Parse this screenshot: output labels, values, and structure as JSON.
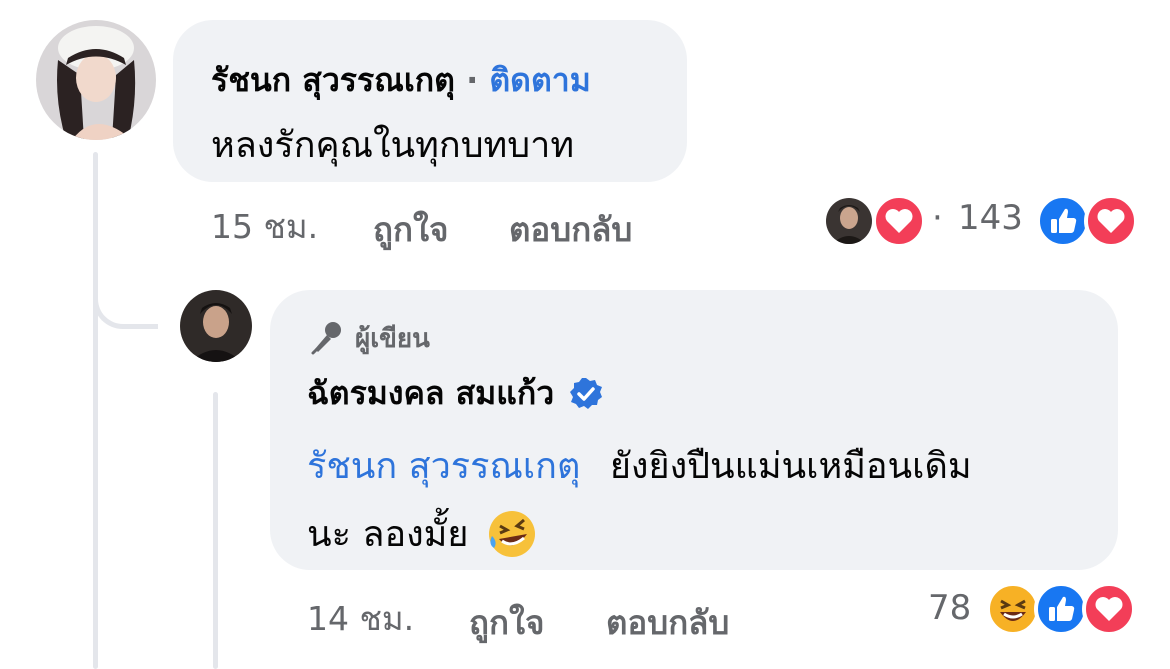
{
  "comment": {
    "author": "รัชนก สุวรรณเกตุ",
    "separator": "·",
    "follow_label": "ติดตาม",
    "text": "หลงรักคุณในทุกบทบาท",
    "time": "15 ชม.",
    "like_label": "ถูกใจ",
    "reply_label": "ตอบกลับ",
    "reaction_dot": "·",
    "reaction_count": "143",
    "reaction_icons": [
      "avatar-reactor",
      "love-icon",
      "like-icon",
      "love-icon"
    ]
  },
  "reply": {
    "badge_label": "ผู้เขียน",
    "badge_icon": "microphone-icon",
    "author": "ฉัตรมงคล สมแก้ว",
    "verified_icon": "verified-badge-icon",
    "mention": "รัชนก สุวรรณเกตุ",
    "text_line1": "ยังยิงปืนแม่นเหมือนเดิม",
    "text_line2": "นะ ลองมั้ย",
    "emoji": "🤣",
    "time": "14 ชม.",
    "like_label": "ถูกใจ",
    "reply_label": "ตอบกลับ",
    "reaction_count": "78",
    "reaction_icons": [
      "haha-icon",
      "like-icon",
      "love-icon"
    ]
  },
  "colors": {
    "bubble": "#f0f2f5",
    "link": "#2e74db",
    "meta": "#65676b",
    "like": "#1877f2",
    "love": "#f33e58"
  }
}
